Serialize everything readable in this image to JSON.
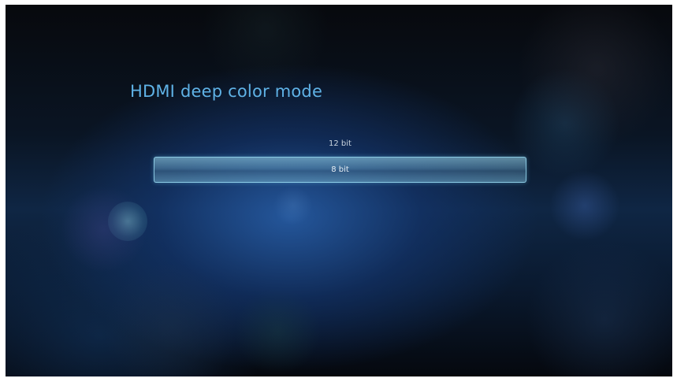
{
  "screen": {
    "title": "HDMI deep color mode"
  },
  "options": [
    {
      "label": "12 bit",
      "selected": false
    },
    {
      "label": "8 bit",
      "selected": true
    }
  ],
  "colors": {
    "title": "#5fb2e6",
    "selection_border": "#96d7f0",
    "background": "#0f2644"
  }
}
